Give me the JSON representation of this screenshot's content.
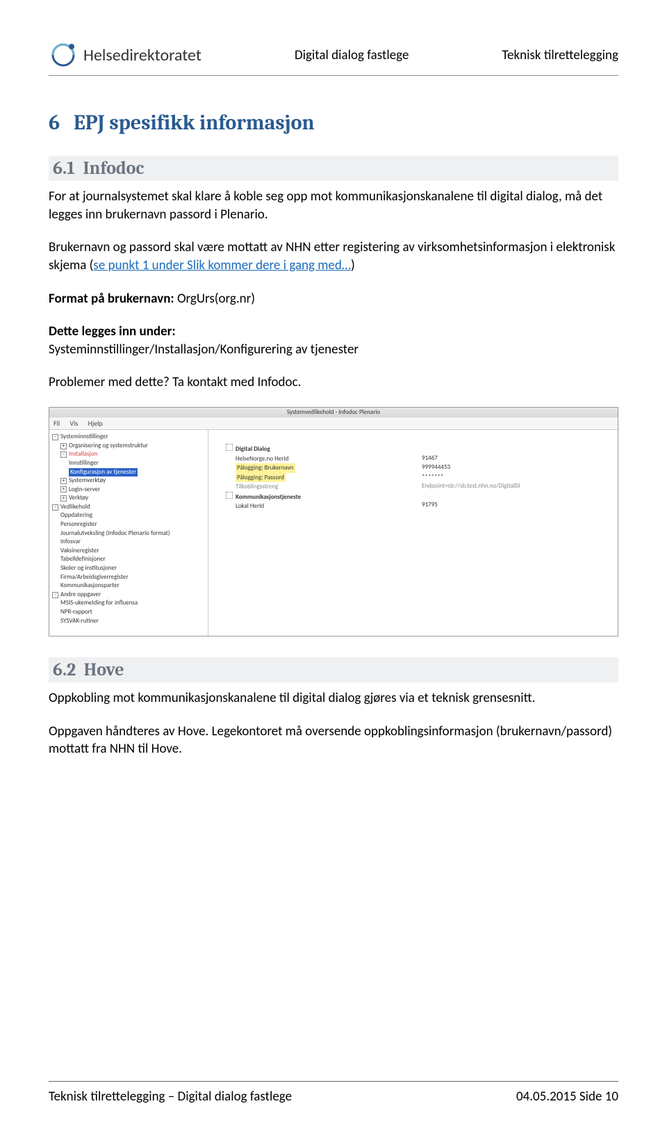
{
  "header": {
    "logo_text": "Helsedirektoratet",
    "center": "Digital dialog fastlege",
    "right": "Teknisk tilrettelegging"
  },
  "sections": {
    "s6": {
      "num": "6",
      "title": "EPJ spesifikk informasjon"
    },
    "s61": {
      "num": "6.1",
      "title": "Infodoc",
      "p1": "For at journalsystemet skal klare å koble seg opp mot kommunikasjonskanalene til digital dialog, må det legges inn brukernavn passord i Plenario.",
      "p2_a": "Brukernavn og passord skal være mottatt av NHN etter registering av virksomhetsinformasjon i elektronisk skjema (",
      "p2_link": "se punkt 1 under Slik kommer dere i gang med…",
      "p2_b": ")",
      "p3_label": "Format på brukernavn:",
      "p3_value": " OrgUrs(org.nr)",
      "p4_label": "Dette legges inn under:",
      "p4_value": "Systeminnstillinger/Installasjon/Konfigurering av tjenester",
      "p5": "Problemer med dette? Ta kontakt med Infodoc."
    },
    "s62": {
      "num": "6.2",
      "title": "Hove",
      "p1": "Oppkobling mot kommunikasjonskanalene til digital dialog gjøres via et teknisk grensesnitt.",
      "p2": "Oppgaven håndteres av Hove. Legekontoret må oversende oppkoblingsinformasjon (brukernavn/passord) mottatt fra NHN til Hove."
    }
  },
  "screenshot": {
    "title": "Systemvedlikehold - Infodoc Plenario",
    "menu": {
      "m1": "Fil",
      "m2": "Vis",
      "m3": "Hjelp"
    },
    "tree": {
      "n0": "Systeminnstillinger",
      "n1": "Organisering og systemstruktur",
      "n2": "Installasjon",
      "n3": "Innstillinger",
      "n4": "Konfigurasjon av tjenester",
      "n5": "Systemverktøy",
      "n6": "Login-server",
      "n7": "Verktøy",
      "n8": "Vedlikehold",
      "n9": "Oppdatering",
      "n10": "Personregister",
      "n11": "Journalutveksling (Infodoc Plenario format)",
      "n12": "Infosvar",
      "n13": "Vaksineregister",
      "n14": "Tabelldefinisjoner",
      "n15": "Skoler og institusjoner",
      "n16": "Firma/Arbeidsgiverregister",
      "n17": "Kommunikasjonsparter",
      "n18": "Andre oppgaver",
      "n19": "MSIS-ukemelding for influensa",
      "n20": "NPR-rapport",
      "n21": "SYSVAK-rutiner"
    },
    "right": {
      "r0": "Digital Dialog",
      "r1": "HelseNorge.no HerId",
      "r2": "Pålogging: Brukernavn",
      "r3": "Pålogging: Passord",
      "r4": "Tilkoblingsstreng",
      "r5": "Kommunikasjonstjeneste",
      "r6": "Lokal HerId",
      "v1": "91467",
      "v2": "999944453",
      "v3": "*******",
      "v4": "Endpoint=sb://sb.test.nhn.no/DigitalDi",
      "v6": "91795"
    }
  },
  "footer": {
    "left": "Teknisk tilrettelegging – Digital dialog fastlege",
    "right": "04.05.2015 Side 10"
  }
}
